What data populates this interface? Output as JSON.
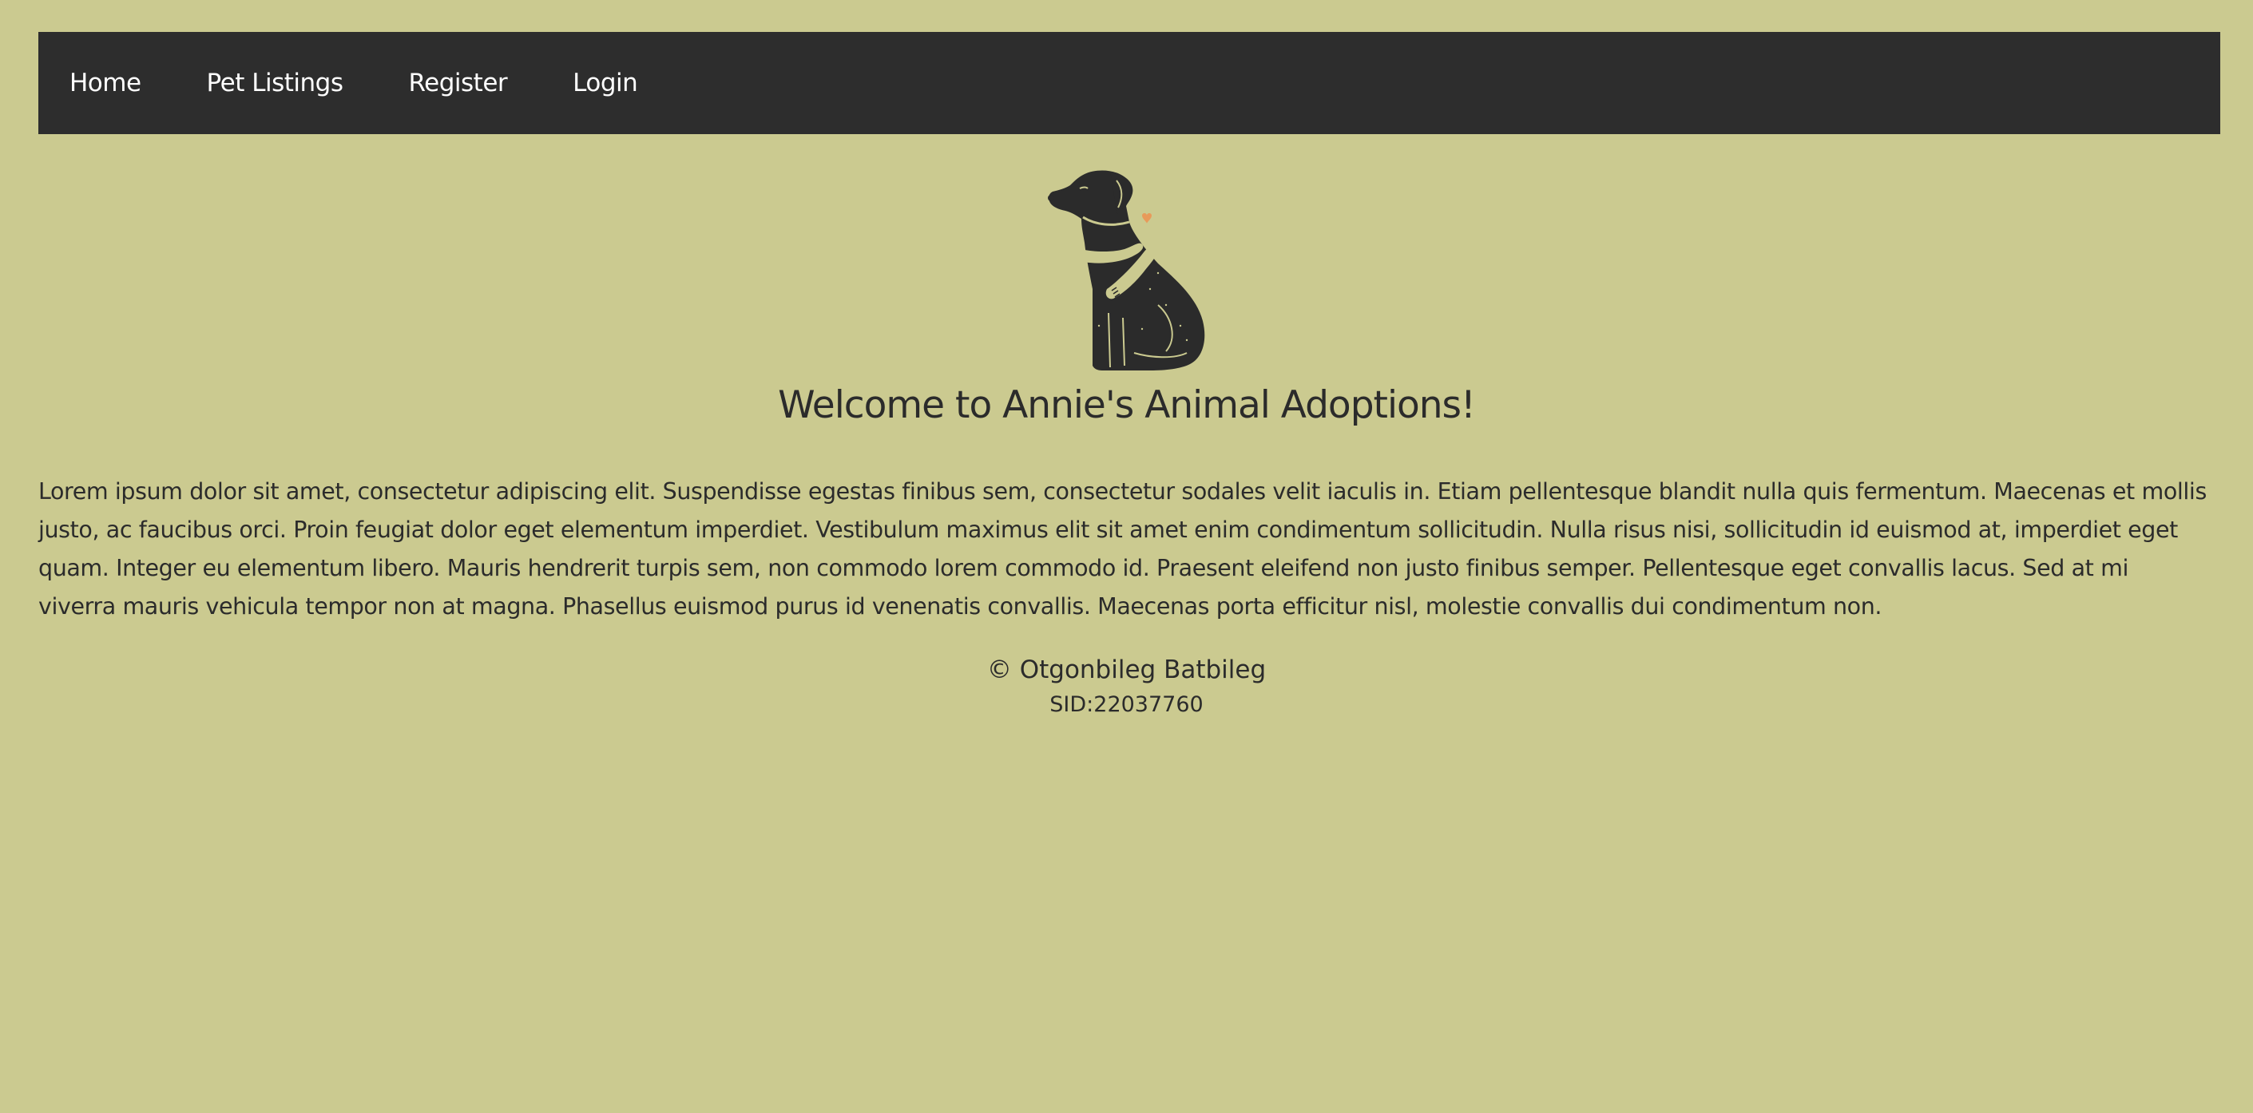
{
  "nav": {
    "items": [
      {
        "label": "Home"
      },
      {
        "label": "Pet Listings"
      },
      {
        "label": "Register"
      },
      {
        "label": "Login"
      }
    ]
  },
  "main": {
    "title": "Welcome to Annie's Animal Adoptions!",
    "intro": "Lorem ipsum dolor sit amet, consectetur adipiscing elit. Suspendisse egestas finibus sem, consectetur sodales velit iaculis in. Etiam pellentesque blandit nulla quis fermentum. Maecenas et mollis justo, ac faucibus orci. Proin feugiat dolor eget elementum imperdiet. Vestibulum maximus elit sit amet enim condimentum sollicitudin. Nulla risus nisi, sollicitudin id euismod at, imperdiet eget quam. Integer eu elementum libero. Mauris hendrerit turpis sem, non commodo lorem commodo id. Praesent eleifend non justo finibus semper. Pellentesque eget convallis lacus. Sed at mi viverra mauris vehicula tempor non at magna. Phasellus euismod purus id venenatis convallis. Maecenas porta efficitur nisl, molestie convallis dui condimentum non."
  },
  "footer": {
    "copyright": "© Otgonbileg Batbileg",
    "sid": "SID:22037760"
  },
  "colors": {
    "background": "#cbca90",
    "navbar": "#2d2d2d",
    "text": "#2b2b2b",
    "heart": "#e89a5a"
  },
  "icons": {
    "logo": "dog-hug-icon"
  }
}
